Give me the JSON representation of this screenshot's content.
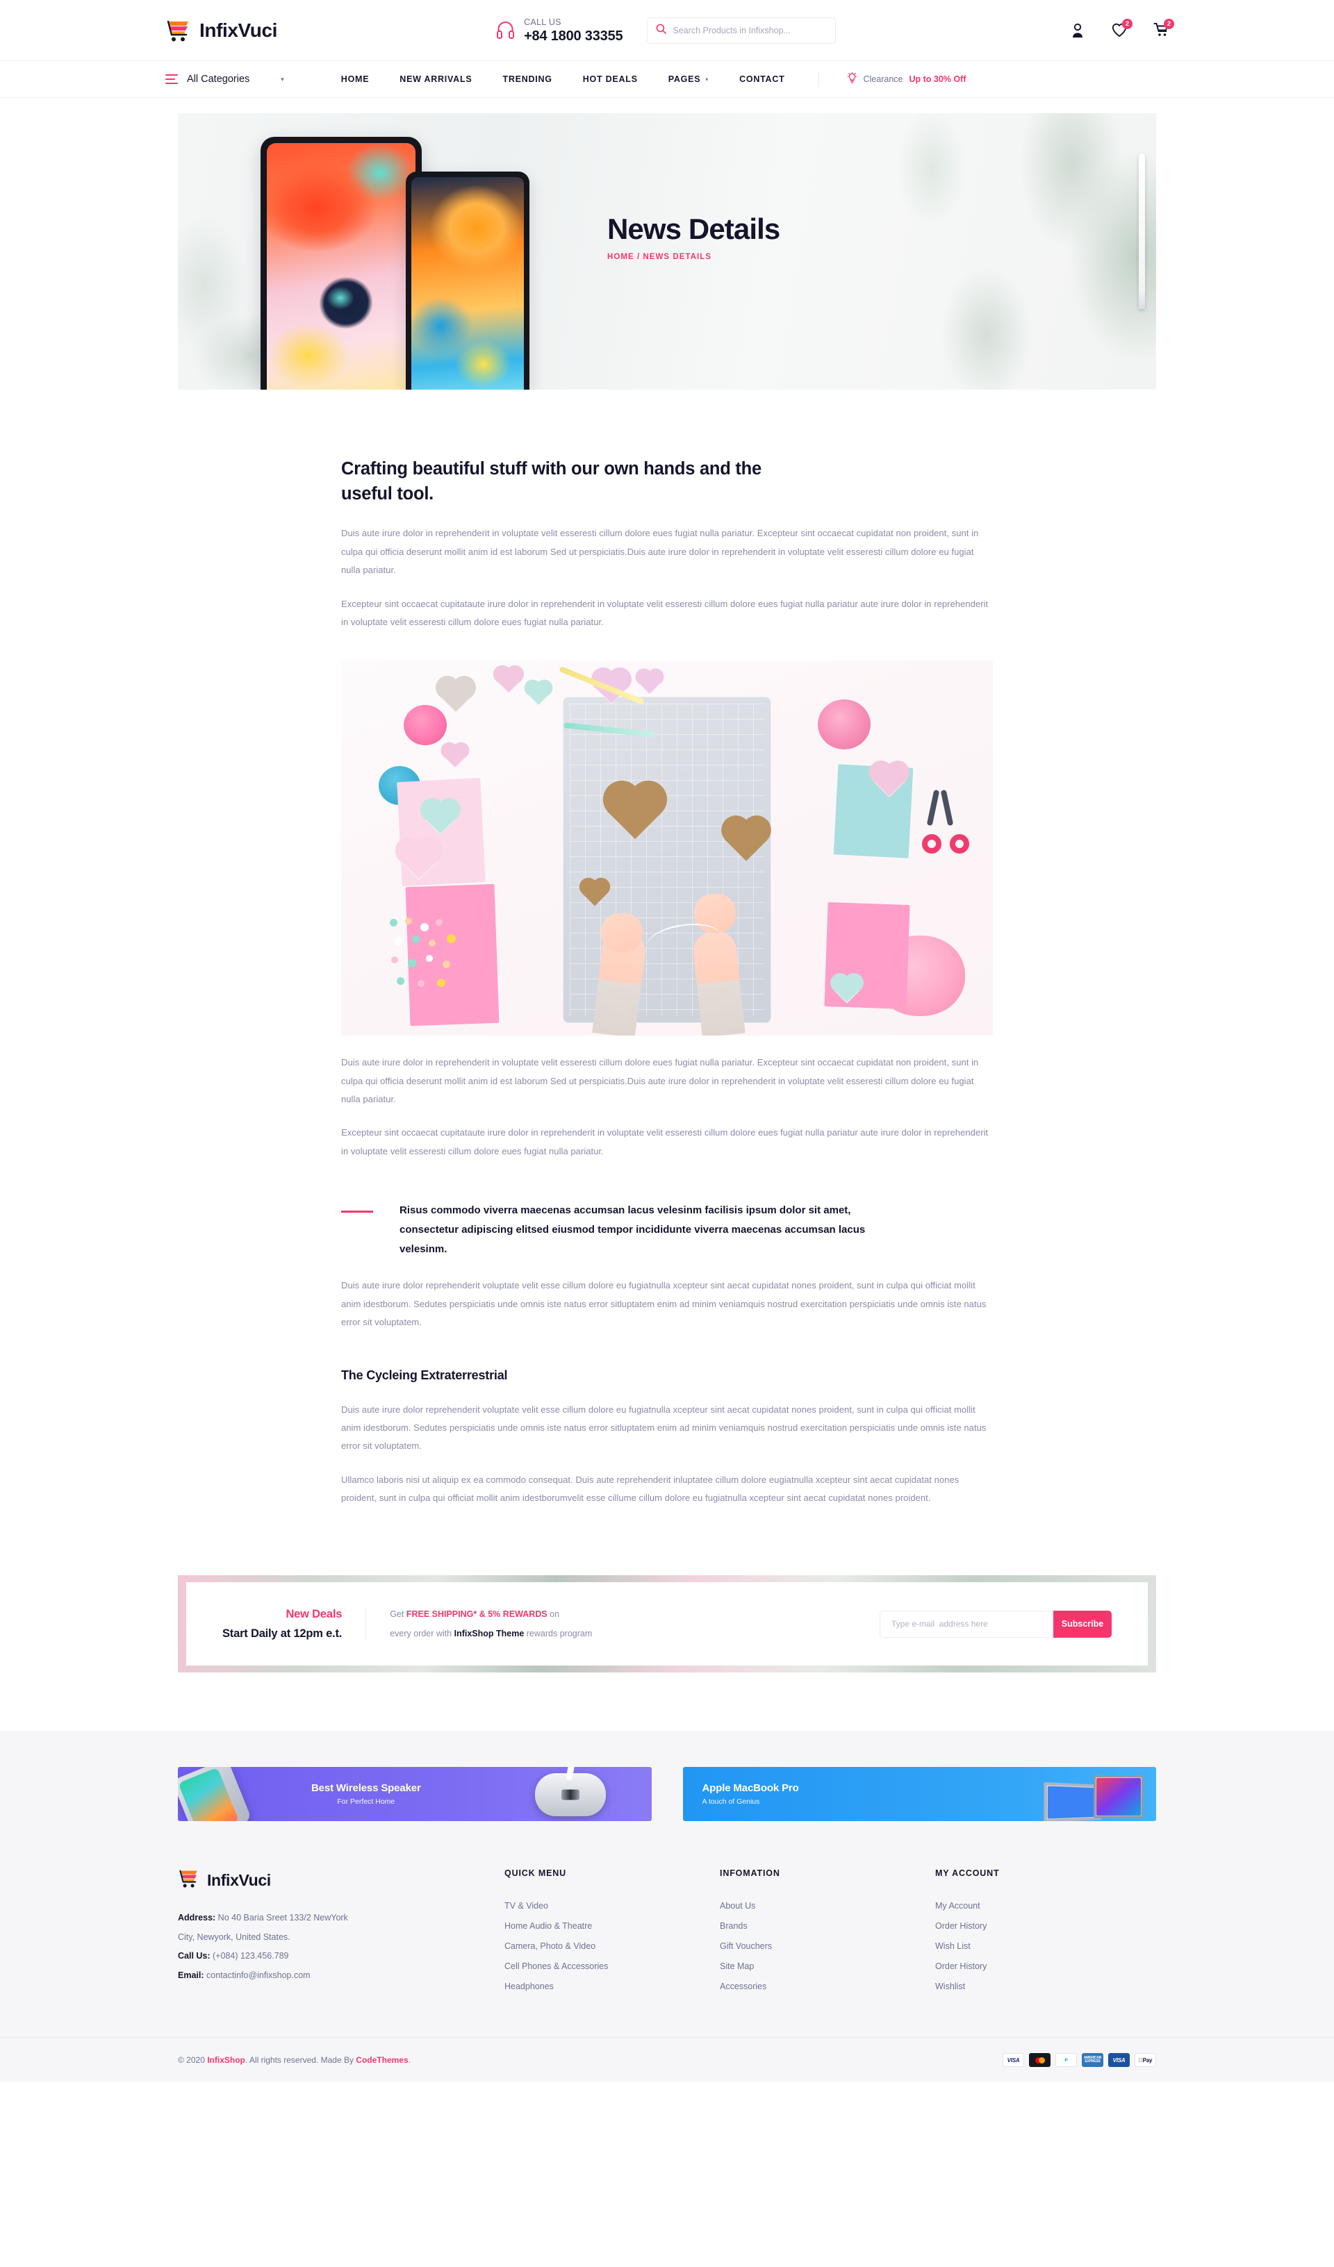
{
  "header": {
    "brand": "InfixVuci",
    "call_label": "CALL US",
    "call_number": "+84 1800 33355",
    "search_placeholder": "Search Products in Infixshop...",
    "search_value": "",
    "wishlist_count": "2",
    "cart_count": "2",
    "icons": {
      "search": "search-icon",
      "headset": "headset-icon",
      "account": "user-icon",
      "wishlist": "heart-icon",
      "cart": "cart-icon"
    }
  },
  "nav": {
    "all_categories": "All Categories",
    "items": [
      {
        "label": "HOME",
        "has_caret": false
      },
      {
        "label": "NEW ARRIVALS",
        "has_caret": false
      },
      {
        "label": "TRENDING",
        "has_caret": false
      },
      {
        "label": "HOT DEALS",
        "has_caret": false
      },
      {
        "label": "PAGES",
        "has_caret": true
      },
      {
        "label": "CONTACT",
        "has_caret": false
      }
    ],
    "clearance_prefix": "Clearance ",
    "clearance_offer": "Up to 30% Off"
  },
  "hero": {
    "title": "News Details",
    "breadcrumb": "HOME / NEWS DETAILS"
  },
  "article": {
    "heading": "Crafting beautiful stuff with our own hands and the useful tool.",
    "para1": "Duis aute irure dolor in reprehenderit in voluptate velit esseresti cillum dolore eues fugiat nulla pariatur. Excepteur sint occaecat cupidatat non proident, sunt in culpa qui officia deserunt mollit anim id est laborum Sed ut perspiciatis.Duis aute irure dolor in reprehenderit in voluptate velit esseresti cillum dolore eu fugiat nulla pariatur.",
    "para2": "Excepteur sint occaecat cupitataute irure dolor in reprehenderit in voluptate velit esseresti cillum dolore eues fugiat nulla pariatur aute irure dolor in reprehenderit in voluptate velit esseresti cillum dolore eues fugiat nulla pariatur.",
    "para3": "Duis aute irure dolor in reprehenderit in voluptate velit esseresti cillum dolore eues fugiat nulla pariatur. Excepteur sint occaecat cupidatat non proident, sunt in culpa qui officia deserunt mollit anim id est laborum Sed ut perspiciatis.Duis aute irure dolor in reprehenderit in voluptate velit esseresti cillum dolore eu fugiat nulla pariatur.",
    "para4": "Excepteur sint occaecat cupitataute irure dolor in reprehenderit in voluptate velit esseresti cillum dolore eues fugiat nulla pariatur aute irure dolor in reprehenderit in voluptate velit esseresti cillum dolore eues fugiat nulla pariatur.",
    "quote": "Risus commodo viverra maecenas accumsan lacus velesinm facilisis ipsum dolor sit amet, consectetur adipiscing elitsed eiusmod tempor incididunte viverra maecenas accumsan lacus velesinm.",
    "para5": "Duis aute irure dolor reprehenderit  voluptate velit esse cillum dolore eu fugiatnulla xcepteur sint aecat cupidatat nones proident, sunt in culpa qui officiat mollit anim idestborum. Sedutes perspiciatis unde omnis iste natus error sitluptatem  enim ad minim veniamquis nostrud exercitation perspiciatis unde omnis iste natus error sit voluptatem.",
    "heading2": "The Cycleing Extraterrestrial",
    "para6": "Duis aute irure dolor reprehenderit  voluptate velit esse cillum dolore eu fugiatnulla xcepteur sint aecat cupidatat nones proident, sunt in culpa qui officiat mollit anim idestborum. Sedutes perspiciatis unde omnis iste natus error sitluptatem  enim ad minim veniamquis nostrud exercitation perspiciatis unde omnis iste natus error sit voluptatem.",
    "para7": "Ullamco laboris nisi ut aliquip ex ea commodo consequat. Duis aute  reprehenderit inluptatee cillum dolore eugiatnulla xcepteur sint aecat cupidatat nones proident, sunt in culpa qui officiat mollit anim idestborumvelit esse cillume cillum dolore eu fugiatnulla xcepteur sint aecat cupidatat nones proident."
  },
  "subscribe": {
    "new_deals": "New Deals",
    "start_daily": "Start Daily at 12pm e.t.",
    "line1_pre": "Get ",
    "line1_strong": "FREE SHIPPING* & 5% REWARDS",
    "line1_post": " on",
    "line2_pre": "every order with ",
    "line2_strong": "InfixShop Theme",
    "line2_post": " rewards program",
    "email_placeholder": "Type e-mail  address here",
    "email_value": "",
    "button": "Subscribe"
  },
  "promos": [
    {
      "title": "Best Wireless Speaker",
      "subtitle": "For Perfect Home"
    },
    {
      "title": "Apple MacBook Pro",
      "subtitle": "A touch of Genius"
    }
  ],
  "footer": {
    "brand": "InfixVuci",
    "address_label": "Address:",
    "address_line1": " No 40 Baria Sreet 133/2 NewYork",
    "address_line2": "City, Newyork, United States.",
    "call_label": "Call Us:",
    "call_value": " (+084) 123.456.789",
    "email_label": "Email:",
    "email_value": " contactinfo@infixshop.com",
    "columns": [
      {
        "title": "QUICK MENU",
        "links": [
          "TV & Video",
          "Home Audio & Theatre",
          "Camera, Photo & Video",
          "Cell Phones & Accessories",
          "Headphones"
        ]
      },
      {
        "title": "INFOMATION",
        "links": [
          "About Us",
          "Brands",
          "Gift Vouchers",
          "Site Map",
          "Accessories"
        ]
      },
      {
        "title": "MY ACCOUNT",
        "links": [
          "My Account",
          "Order History",
          "Wish List",
          "Order History",
          "Wishlist"
        ]
      }
    ],
    "copyright_pre": "© 2020 ",
    "copyright_brand": "InfixShop",
    "copyright_mid": ". All rights reserved. Made By ",
    "copyright_author": "CodeThemes",
    "copyright_end": ".",
    "payments": [
      "VISA",
      "mastercard",
      "PayPal",
      "AMERICAN EXPRESS",
      "VISA Electron",
      "Apple Pay"
    ]
  },
  "colors": {
    "accent": "#f5366c",
    "dark": "#14142b",
    "muted": "#6e7191",
    "body_text": "#8b8ba7"
  }
}
